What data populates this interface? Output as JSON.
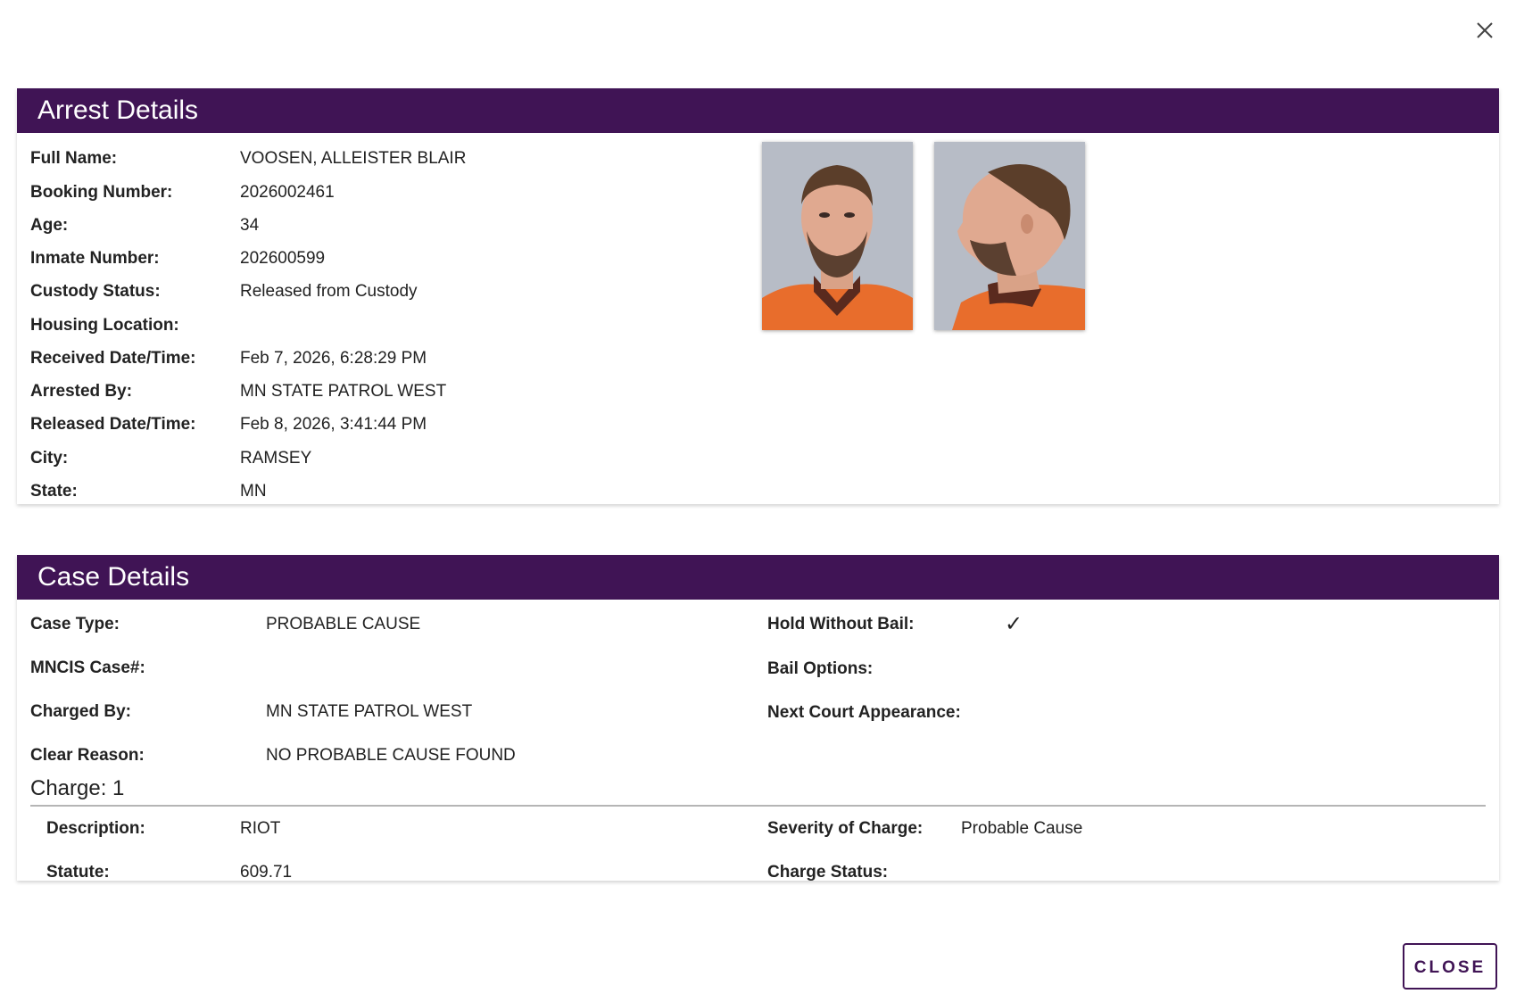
{
  "arrest": {
    "title": "Arrest Details",
    "fields": [
      {
        "label": "Full Name:",
        "value": "VOOSEN, ALLEISTER BLAIR"
      },
      {
        "label": "Booking Number:",
        "value": "2026002461"
      },
      {
        "label": "Age:",
        "value": "34"
      },
      {
        "label": "Inmate Number:",
        "value": "202600599"
      },
      {
        "label": "Custody Status:",
        "value": "Released from Custody"
      },
      {
        "label": "Housing Location:",
        "value": ""
      },
      {
        "label": "Received Date/Time:",
        "value": "Feb 7, 2026, 6:28:29 PM"
      },
      {
        "label": "Arrested By:",
        "value": "MN STATE PATROL WEST"
      },
      {
        "label": "Released Date/Time:",
        "value": "Feb 8, 2026, 3:41:44 PM"
      },
      {
        "label": "City:",
        "value": "RAMSEY"
      },
      {
        "label": "State:",
        "value": "MN"
      }
    ]
  },
  "case": {
    "title": "Case Details",
    "left_fields": [
      {
        "label": "Case Type:",
        "value": "PROBABLE CAUSE"
      },
      {
        "label": "MNCIS Case#:",
        "value": ""
      },
      {
        "label": "Charged By:",
        "value": "MN STATE PATROL WEST"
      },
      {
        "label": "Clear Reason:",
        "value": "NO PROBABLE CAUSE FOUND"
      }
    ],
    "right_fields": [
      {
        "label": "Hold Without Bail:",
        "value": "✓"
      },
      {
        "label": "Bail Options:",
        "value": ""
      },
      {
        "label": "Next Court Appearance:",
        "value": ""
      }
    ],
    "charge": {
      "title": "Charge: 1",
      "left_fields": [
        {
          "label": "Description:",
          "value": "RIOT"
        },
        {
          "label": "Statute:",
          "value": "609.71"
        }
      ],
      "right_fields": [
        {
          "label": "Severity of Charge:",
          "value": "Probable Cause"
        },
        {
          "label": "Charge Status:",
          "value": ""
        }
      ]
    }
  },
  "footer": {
    "close_label": "CLOSE"
  },
  "colors": {
    "header_bg": "#401455",
    "accent": "#401455"
  }
}
